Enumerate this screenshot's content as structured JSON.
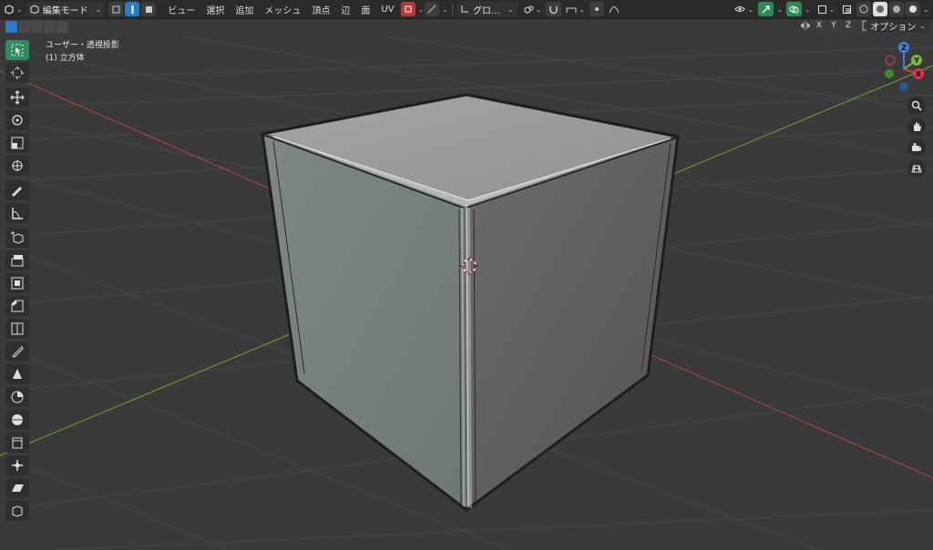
{
  "header": {
    "editor_type_icon": "cube-editor-icon",
    "mode_label": "編集モード",
    "menus": [
      "ビュー",
      "選択",
      "追加",
      "メッシュ",
      "頂点",
      "辺",
      "面",
      "UV"
    ],
    "transform_orientation": "グロ…",
    "options_label": "オプション"
  },
  "axes": {
    "x": "X",
    "y": "Y",
    "z": "Z"
  },
  "viewport_info": {
    "view_name": "ユーザー・透視投影",
    "object_name": "(1) 立方体"
  },
  "toolbar": {
    "tools": [
      "select-box-icon",
      "cursor-icon",
      "move-icon",
      "rotate-icon",
      "scale-icon",
      "transform-icon",
      "annotate-icon",
      "measure-icon",
      "add-cube-icon",
      "extrude-icon",
      "inset-icon",
      "bevel-icon",
      "loop-cut-icon",
      "knife-icon",
      "poly-build-icon",
      "spin-icon",
      "smooth-icon",
      "edge-slide-icon",
      "shrink-fatten-icon",
      "shear-icon",
      "rip-icon"
    ]
  },
  "gizmo": {
    "z_label": "Z",
    "y_label": "Y",
    "x_label": "X",
    "colors": {
      "x": "#e0344b",
      "y": "#79b833",
      "z": "#3c82d7"
    }
  },
  "nav_buttons": [
    "zoom-icon",
    "pan-hand-icon",
    "camera-icon",
    "grid-ortho-icon"
  ],
  "colors": {
    "background": "#3a3a3a",
    "header": "#2b2b2b",
    "accent_blue": "#2a7ac7",
    "accent_green": "#2e8a5f",
    "x_axis": "#c0434f",
    "y_axis": "#7fa33a"
  }
}
